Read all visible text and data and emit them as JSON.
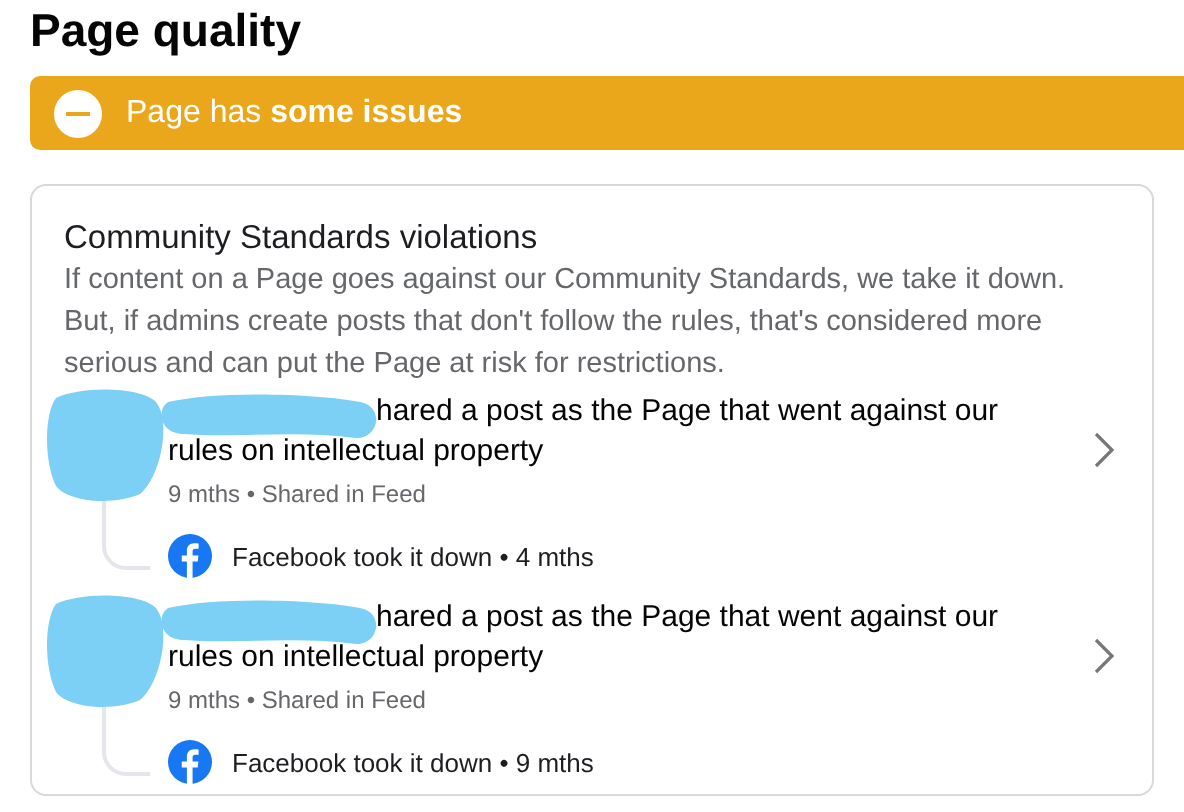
{
  "title": "Page quality",
  "banner": {
    "kind": "warning",
    "text": "Page has **some issues**"
  },
  "card": {
    "heading": "Community Standards violations",
    "description": "If content on a Page goes against our Community Standards, we take it down. But, if admins create posts that don't follow the rules, that's considered more serious and can put the Page at risk for restrictions.",
    "violations": [
      {
        "redacted": true,
        "message": "hared a post as the Page that went against our rules on intellectual property",
        "meta": "9 mths • Shared in Feed",
        "action": "Facebook took it down • 4 mths"
      },
      {
        "redacted": true,
        "message": "hared a post as the Page that went against our rules on intellectual property",
        "meta": "9 mths • Shared in Feed",
        "action": "Facebook took it down • 9 mths"
      }
    ]
  }
}
